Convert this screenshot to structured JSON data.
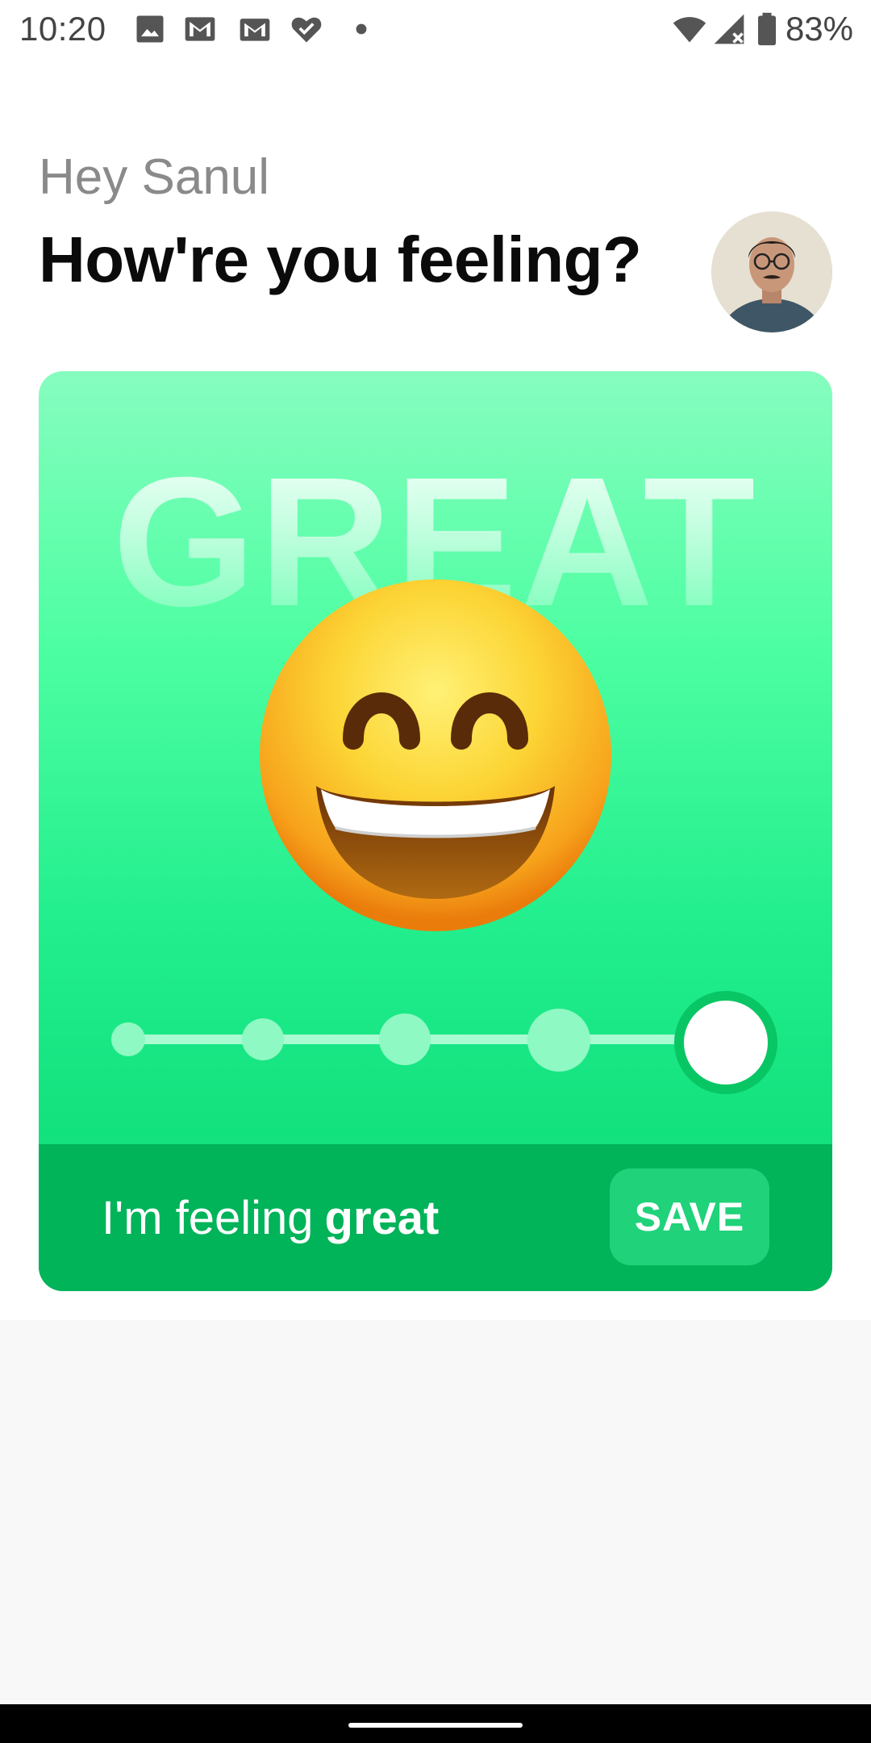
{
  "status_bar": {
    "time": "10:20",
    "battery_percent": "83%",
    "icons": [
      "image-icon",
      "gmail-icon",
      "gmail-icon",
      "heart-check-icon",
      "dot-icon",
      "wifi-icon",
      "signal-icon",
      "battery-icon"
    ]
  },
  "header": {
    "greeting": "Hey Sanul",
    "title": "How're you feeling?"
  },
  "mood_card": {
    "mood_word": "GREAT",
    "emoji": "grinning-face-with-smiling-eyes",
    "slider": {
      "steps": 5,
      "selected_index": 4
    },
    "footer": {
      "prefix": "I'm feeling",
      "mood": "great",
      "save_label": "SAVE"
    }
  },
  "colors": {
    "card_top": "#86fdbf",
    "card_bottom": "#06d873",
    "footer_bg": "#01b359",
    "save_bg": "#20d27a",
    "thumb_border": "#09c665"
  }
}
